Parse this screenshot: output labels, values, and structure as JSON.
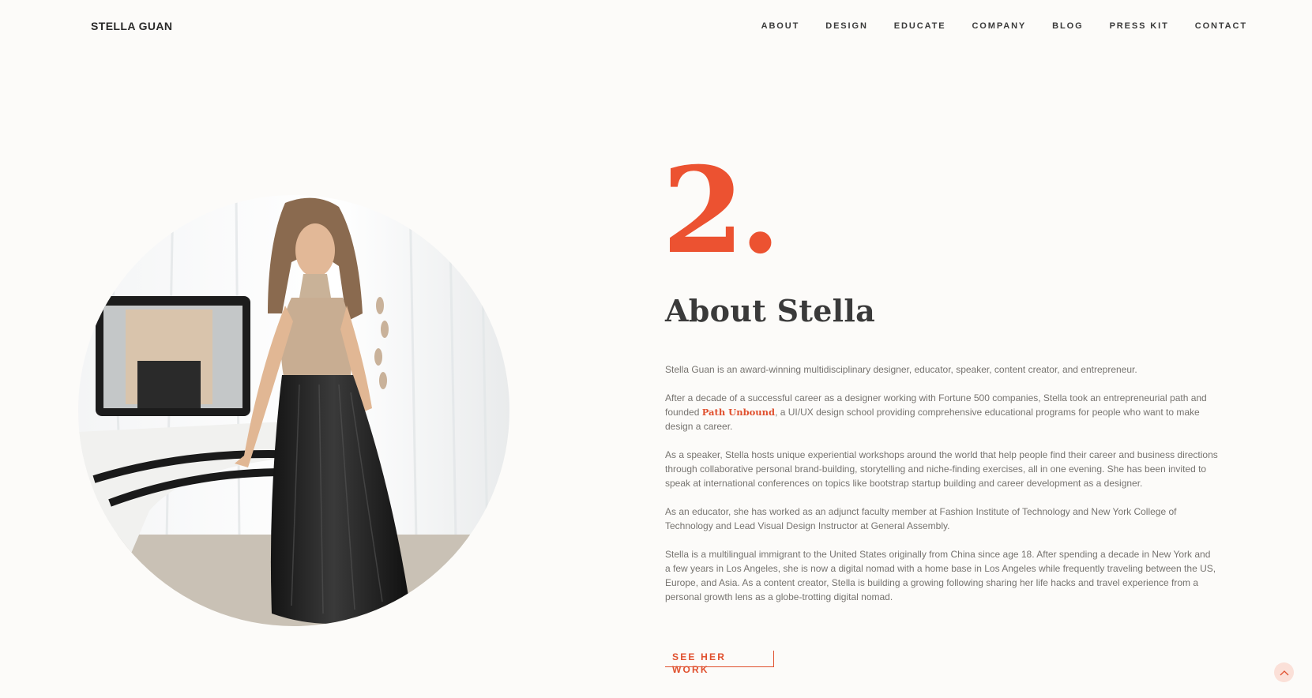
{
  "header": {
    "brand": "STELLA GUAN",
    "nav": [
      "ABOUT",
      "DESIGN",
      "EDUCATE",
      "COMPANY",
      "BLOG",
      "PRESS KIT",
      "CONTACT"
    ]
  },
  "main": {
    "section_number": "2.",
    "title": "About Stella",
    "bio": {
      "p1": "Stella Guan is an award-winning multidisciplinary designer, educator, speaker, content creator, and entrepreneur.",
      "p2_before": "After a decade of a successful career as a designer working with Fortune 500 companies, Stella took an entrepreneurial path and founded ",
      "p2_link": "Path Unbound",
      "p2_after": ", a UI/UX design school providing comprehensive educational programs for people who want to make design a career.",
      "p3": "As a speaker, Stella hosts unique experiential workshops around the world that help people find their career and business directions through collaborative personal brand-building, storytelling and niche-finding exercises, all in one evening. She has been invited to speak at international conferences on topics like bootstrap startup building and career development as a designer.",
      "p4": "As an educator, she has worked as an adjunct faculty member at Fashion Institute of Technology and New York College of Technology and Lead Visual Design Instructor at General Assembly.",
      "p5": "Stella is a multilingual immigrant to the United States originally from China since age 18. After spending a decade in New York and a few years in Los Angeles, she is now a digital nomad with a home base in Los Angeles while frequently traveling between the US, Europe, and Asia. As a content creator, Stella is building a growing following sharing her life hacks and travel experience from a personal growth lens as a globe-trotting digital nomad."
    },
    "cta_label": "SEE HER WORK"
  },
  "icons": {
    "back_to_top": "chevron-up-icon"
  },
  "colors": {
    "accent": "#ec5231",
    "background": "#fcfbf9",
    "heading": "#3a3a3a"
  }
}
